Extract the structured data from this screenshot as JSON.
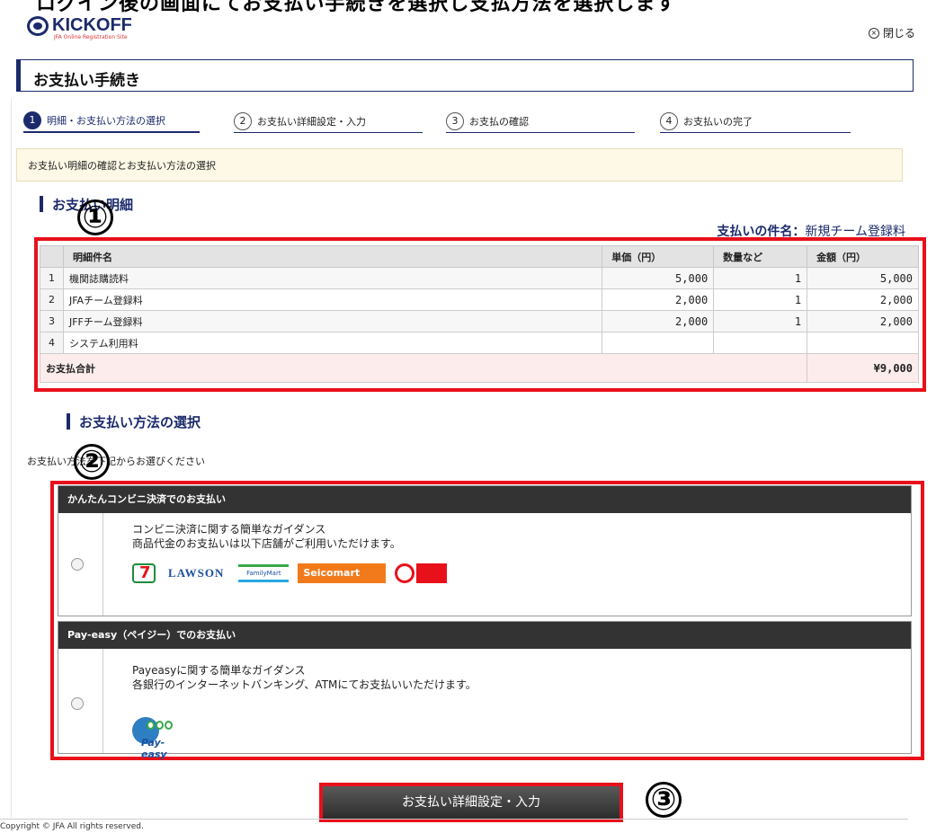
{
  "top_strip": {
    "text": "ログイン後の画面にてお支払い手続きを選択し支払方法を選択します"
  },
  "header": {
    "logo_text": "KICKOFF",
    "logo_sub": "JFA Online Registration Site",
    "close_label": "閉じる"
  },
  "page_title": "お支払い手続き",
  "steps": [
    {
      "num": "1",
      "label": "明細・お支払い方法の選択"
    },
    {
      "num": "2",
      "label": "お支払い詳細設定・入力"
    },
    {
      "num": "3",
      "label": "お支払の確認"
    },
    {
      "num": "4",
      "label": "お支払いの完了"
    }
  ],
  "info_text": "お支払い明細の確認とお支払い方法の選択",
  "detail_section": {
    "heading": "お支払い明細",
    "payment_name_label": "支払いの件名：",
    "payment_name_value": "新規チーム登録料"
  },
  "table": {
    "headers": [
      "明細件名",
      "単価（円）",
      "数量など",
      "金額（円）"
    ],
    "rows": [
      {
        "idx": "1",
        "name": "機関誌購読料",
        "price": "5,000",
        "qty": "1",
        "amount": "5,000"
      },
      {
        "idx": "2",
        "name": "JFAチーム登録料",
        "price": "2,000",
        "qty": "1",
        "amount": "2,000"
      },
      {
        "idx": "3",
        "name": "JFFチーム登録料",
        "price": "2,000",
        "qty": "1",
        "amount": "2,000"
      },
      {
        "idx": "4",
        "name": "システム利用料",
        "price": "",
        "qty": "",
        "amount": ""
      }
    ],
    "total_label": "お支払合計",
    "total_value": "¥9,000"
  },
  "method_section": {
    "heading": "お支払い方法の選択",
    "note": "お支払い方法を下記からお選びください"
  },
  "methods": [
    {
      "title": "かんたんコンビニ決済でのお支払い",
      "line1": "コンビニ決済に関する簡単なガイダンス",
      "line2": "商品代金のお支払いは以下店舗がご利用いただけます。",
      "store_logos": [
        "セブン-イレブン",
        "LAWSON",
        "FamilyMart",
        "Seicomart",
        "サークルK サンクス"
      ]
    },
    {
      "title": "Pay-easy（ペイジー）でのお支払い",
      "line1": "Payeasyに関する簡単なガイダンス",
      "line2": "各銀行のインターネットバンキング、ATMにてお支払いいただけます。",
      "brand": "Pay-easy"
    }
  ],
  "annotations": [
    "①",
    "②",
    "③"
  ],
  "submit_label": "お支払い詳細設定・入力",
  "footer": "Copyright © JFA All rights reserved.",
  "colors": {
    "navy": "#1b2a6b",
    "annotation_red": "#e8101a",
    "info_bg": "#fdf9e6",
    "total_bg": "#fdecec"
  }
}
